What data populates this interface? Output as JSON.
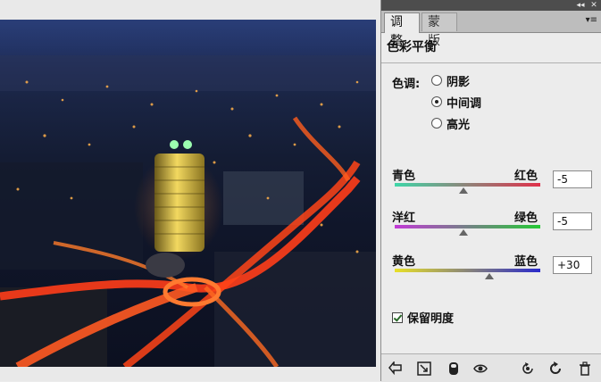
{
  "panel": {
    "titlebar": {
      "collapse_glyph": "◂◂",
      "close_glyph": "✕"
    },
    "tabs": [
      {
        "label": "调整",
        "active": true
      },
      {
        "label": "蒙版",
        "active": false
      }
    ],
    "menu_glyph": "▾≡",
    "title": "色彩平衡",
    "tone": {
      "label": "色调:",
      "options": [
        {
          "label": "阴影",
          "selected": false
        },
        {
          "label": "中间调",
          "selected": true
        },
        {
          "label": "高光",
          "selected": false
        }
      ]
    },
    "sliders": [
      {
        "left": "青色",
        "right": "红色",
        "value": "-5",
        "level": -5,
        "range": [
          -100,
          100
        ],
        "gradient": [
          "#3fd6a8",
          "#e0304a"
        ]
      },
      {
        "left": "洋红",
        "right": "绿色",
        "value": "-5",
        "level": -5,
        "range": [
          -100,
          100
        ],
        "gradient": [
          "#c23ad6",
          "#26c936"
        ]
      },
      {
        "left": "黄色",
        "right": "蓝色",
        "value": "+30",
        "level": 30,
        "range": [
          -100,
          100
        ],
        "gradient": [
          "#e8e028",
          "#2a2acc"
        ]
      }
    ],
    "preserve_luminosity": {
      "label": "保留明度",
      "checked": true
    },
    "bottom_icons": [
      "return-arrow-icon",
      "clip-to-layer-icon",
      "layer-mask-icon",
      "eye-icon",
      "reset-previous-icon",
      "reset-icon",
      "trash-icon"
    ]
  }
}
